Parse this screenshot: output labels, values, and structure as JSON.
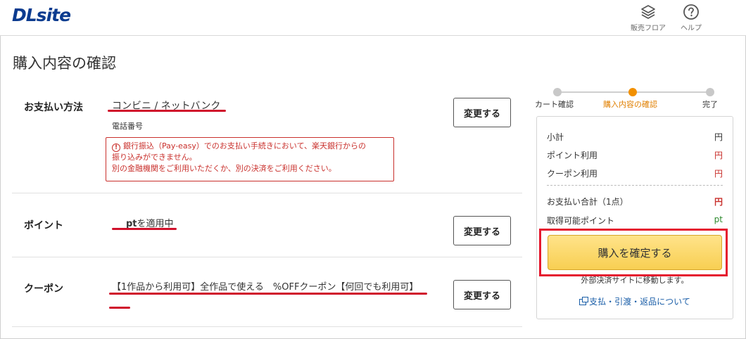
{
  "header": {
    "logo": "DLsite",
    "sales_floor_label": "販売フロア",
    "help_label": "ヘルプ"
  },
  "page": {
    "title": "購入内容の確認"
  },
  "payment": {
    "label": "お支払い方法",
    "method": "コンビニ / ネットバンク",
    "sub": "電話番号",
    "warning_line1": "銀行振込（Pay-easy）でのお支払い手続きにおいて、楽天銀行からの",
    "warning_line2": "振り込みができません。",
    "warning_line3": "別の金融機関をご利用いただくか、別の決済をご利用ください。",
    "change_button": "変更する"
  },
  "point": {
    "label": "ポイント",
    "unit": "pt",
    "status": "を適用中",
    "change_button": "変更する"
  },
  "coupon": {
    "label": "クーポン",
    "text": "【1作品から利用可】全作品で使える　%OFFクーポン【何回でも利用可】",
    "change_button": "変更する"
  },
  "steps": [
    {
      "label": "カート確認",
      "active": false
    },
    {
      "label": "購入内容の確認",
      "active": true
    },
    {
      "label": "完了",
      "active": false
    }
  ],
  "summary": {
    "subtotal_label": "小計",
    "subtotal_value": "円",
    "point_use_label": "ポイント利用",
    "point_use_value": "円",
    "coupon_use_label": "クーポン利用",
    "coupon_use_value": "円",
    "total_label": "お支払い合計（1点）",
    "total_value": "円",
    "earn_label": "取得可能ポイント",
    "earn_value": "pt",
    "confirm_button": "購入を確定する",
    "note": "外部決済サイトに移動します。",
    "policy_link": "支払・引渡・返品について"
  },
  "colors": {
    "accent": "#f29000",
    "warning": "#c9302c",
    "link": "#1a5ea8",
    "highlight": "#e5192f"
  }
}
